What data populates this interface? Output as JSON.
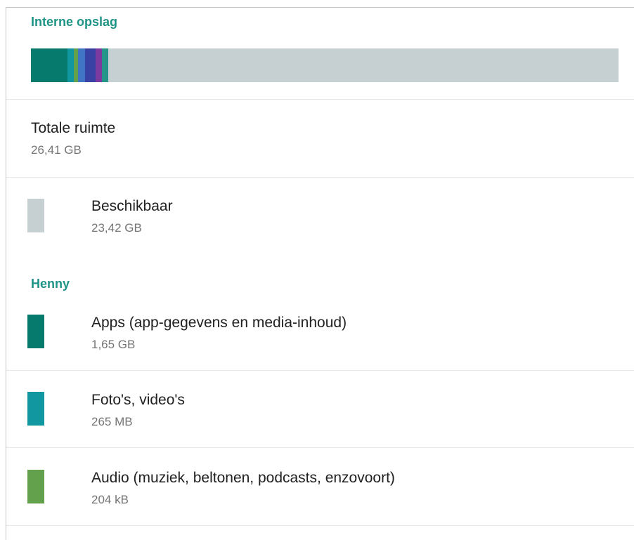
{
  "storage": {
    "header": "Interne opslag",
    "bar": {
      "segments": [
        {
          "name": "apps",
          "color": "#077a6e",
          "fraction": 0.0625
        },
        {
          "name": "photos-videos",
          "color": "#11979f",
          "fraction": 0.01
        },
        {
          "name": "audio",
          "color": "#64a14d",
          "fraction": 0.0077
        },
        {
          "name": "segment-4",
          "color": "#3f75c4",
          "fraction": 0.012
        },
        {
          "name": "segment-5",
          "color": "#3a41a4",
          "fraction": 0.018
        },
        {
          "name": "segment-6",
          "color": "#7a3aa0",
          "fraction": 0.011
        },
        {
          "name": "segment-7",
          "color": "#25958a",
          "fraction": 0.011
        }
      ],
      "free_color": "#c6cfd1"
    },
    "total": {
      "label": "Totale ruimte",
      "value": "26,41 GB"
    },
    "available": {
      "label": "Beschikbaar",
      "value": "23,42 GB",
      "color": "#c6cfd1"
    }
  },
  "user": {
    "header": "Henny",
    "items": [
      {
        "label": "Apps (app-gegevens en media-inhoud)",
        "value": "1,65 GB",
        "color": "#077a6e"
      },
      {
        "label": "Foto's, video's",
        "value": "265 MB",
        "color": "#11979f"
      },
      {
        "label": "Audio (muziek, beltonen, podcasts, enzovoort)",
        "value": "204 kB",
        "color": "#64a14d"
      }
    ]
  }
}
